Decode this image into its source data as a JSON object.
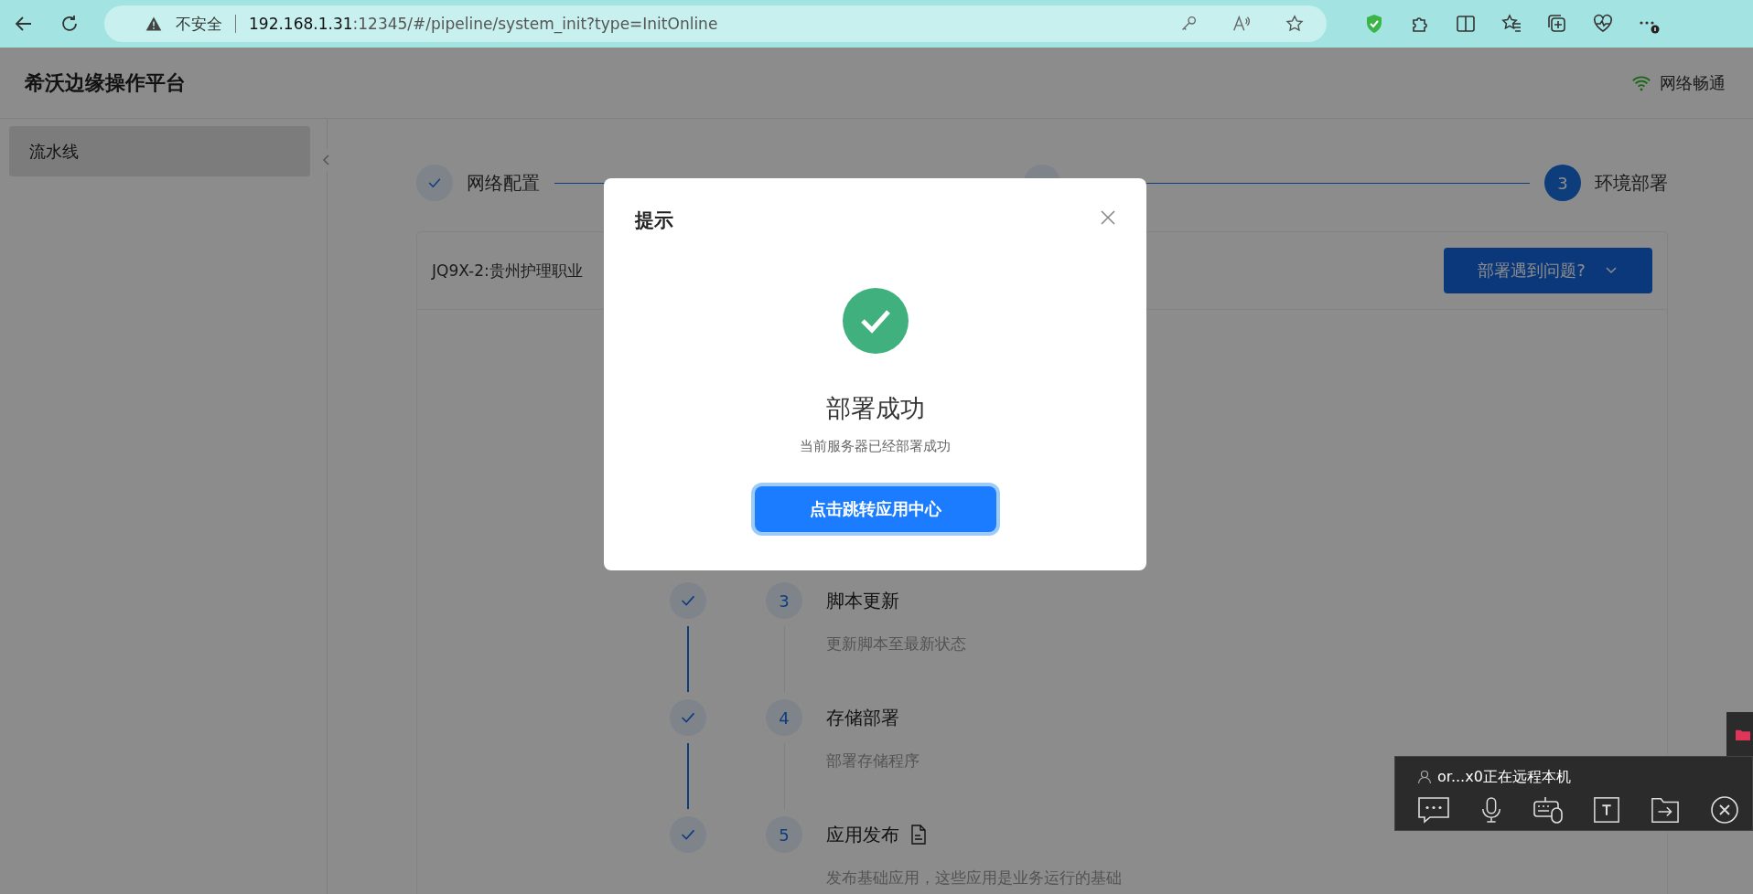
{
  "browser": {
    "security_label": "不安全",
    "url_host": "192.168.1.31",
    "url_rest": ":12345/#/pipeline/system_init?type=InitOnline"
  },
  "header": {
    "title": "希沃边缘操作平台",
    "network_status": "网络畅通"
  },
  "sidebar": {
    "items": [
      {
        "label": "流水线",
        "selected": true
      }
    ]
  },
  "steps": [
    {
      "label": "网络配置",
      "completed": true
    },
    {
      "completed": true
    },
    {
      "number": "3",
      "label": "环境部署",
      "completed": false
    }
  ],
  "card": {
    "device": "JQ9X-2:贵州护理职业",
    "help_button": "部署遇到问题?",
    "tasks": [
      {
        "number": "3",
        "title": "脚本更新",
        "description": "更新脚本至最新状态",
        "done": true,
        "has_doc": false
      },
      {
        "number": "4",
        "title": "存储部署",
        "description": "部署存储程序",
        "done": true,
        "has_doc": false
      },
      {
        "number": "5",
        "title": "应用发布",
        "description": "发布基础应用，这些应用是业务运行的基础",
        "done": true,
        "has_doc": true
      }
    ]
  },
  "dialog": {
    "title": "提示",
    "success": true,
    "heading": "部署成功",
    "message": "当前服务器已经部署成功",
    "button": "点击跳转应用中心"
  },
  "remote_panel": {
    "user_text": "or...x0正在远程本机"
  }
}
